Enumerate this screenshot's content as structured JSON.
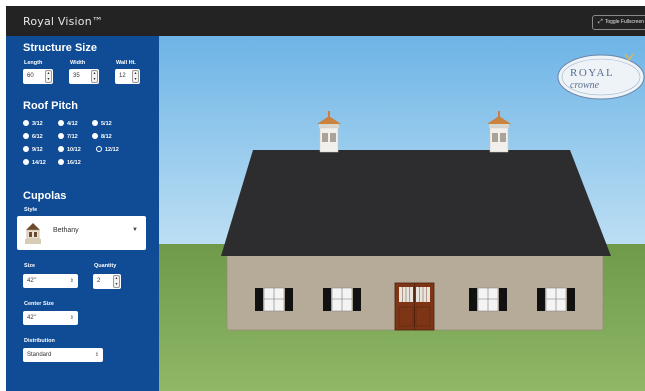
{
  "app": {
    "title": "Royal Vision™",
    "fullscreen_label": "Toggle Fullscreen",
    "fullscreen_icon": "expand-arrows-icon"
  },
  "sidebar": {
    "structure_size": {
      "heading": "Structure Size",
      "length_label": "Length",
      "length_value": "60",
      "width_label": "Width",
      "width_value": "35",
      "wall_label": "Wall Ht.",
      "wall_value": "12"
    },
    "roof_pitch": {
      "heading": "Roof Pitch",
      "options": [
        "3/12",
        "4/12",
        "5/12",
        "6/12",
        "7/12",
        "8/12",
        "9/12",
        "10/12",
        "12/12",
        "14/12",
        "16/12"
      ],
      "selected": "12/12"
    },
    "cupolas": {
      "heading": "Cupolas",
      "style_label": "Style",
      "style_value": "Bethany",
      "size_label": "Size",
      "size_value": "42\"",
      "quantity_label": "Quantity",
      "quantity_value": "2",
      "center_size_label": "Center Size",
      "center_size_value": "42\"",
      "distribution_label": "Distribution",
      "distribution_value": "Standard"
    }
  },
  "scene": {
    "logo_line1": "ROYAL",
    "logo_line2": "crowne",
    "colors": {
      "sidebar": "#0f4c95",
      "topbar": "#232323",
      "roof": "#2d2d2f",
      "siding": "#b6ab98",
      "door": "#7d3516",
      "grass": "#7ea85a",
      "sky": "#7fc0ea"
    }
  }
}
